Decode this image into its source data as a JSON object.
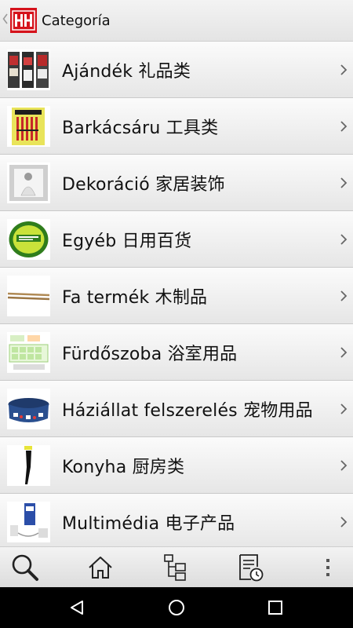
{
  "app": {
    "title": "Categoría",
    "logo_name": "hh-logo",
    "brand_color": "#d5121b"
  },
  "categories": [
    {
      "label": "Ajándék 礼品类",
      "thumb_icon": "gift-items-thumbnail"
    },
    {
      "label": "Barkácsáru 工具类",
      "thumb_icon": "screwdriver-set-thumbnail"
    },
    {
      "label": "Dekoráció 家居装饰",
      "thumb_icon": "photo-frame-thumbnail"
    },
    {
      "label": "Egyéb 日用百货",
      "thumb_icon": "round-tin-thumbnail"
    },
    {
      "label": "Fa termék 木制品",
      "thumb_icon": "wooden-sticks-thumbnail"
    },
    {
      "label": "Fürdőszoba 浴室用品",
      "thumb_icon": "bath-set-thumbnail"
    },
    {
      "label": "Háziállat felszerelés 宠物用品",
      "thumb_icon": "pet-bed-thumbnail"
    },
    {
      "label": "Konyha 厨房类",
      "thumb_icon": "kitchen-utensil-thumbnail"
    },
    {
      "label": "Multimédia 电子产品",
      "thumb_icon": "electronics-thumbnail"
    }
  ],
  "bottom_bar": {
    "items": [
      "search-icon",
      "home-icon",
      "category-tree-icon",
      "order-history-icon",
      "more-vertical-icon"
    ]
  },
  "system_nav": {
    "items": [
      "back-triangle-icon",
      "home-circle-icon",
      "recents-square-icon"
    ]
  }
}
